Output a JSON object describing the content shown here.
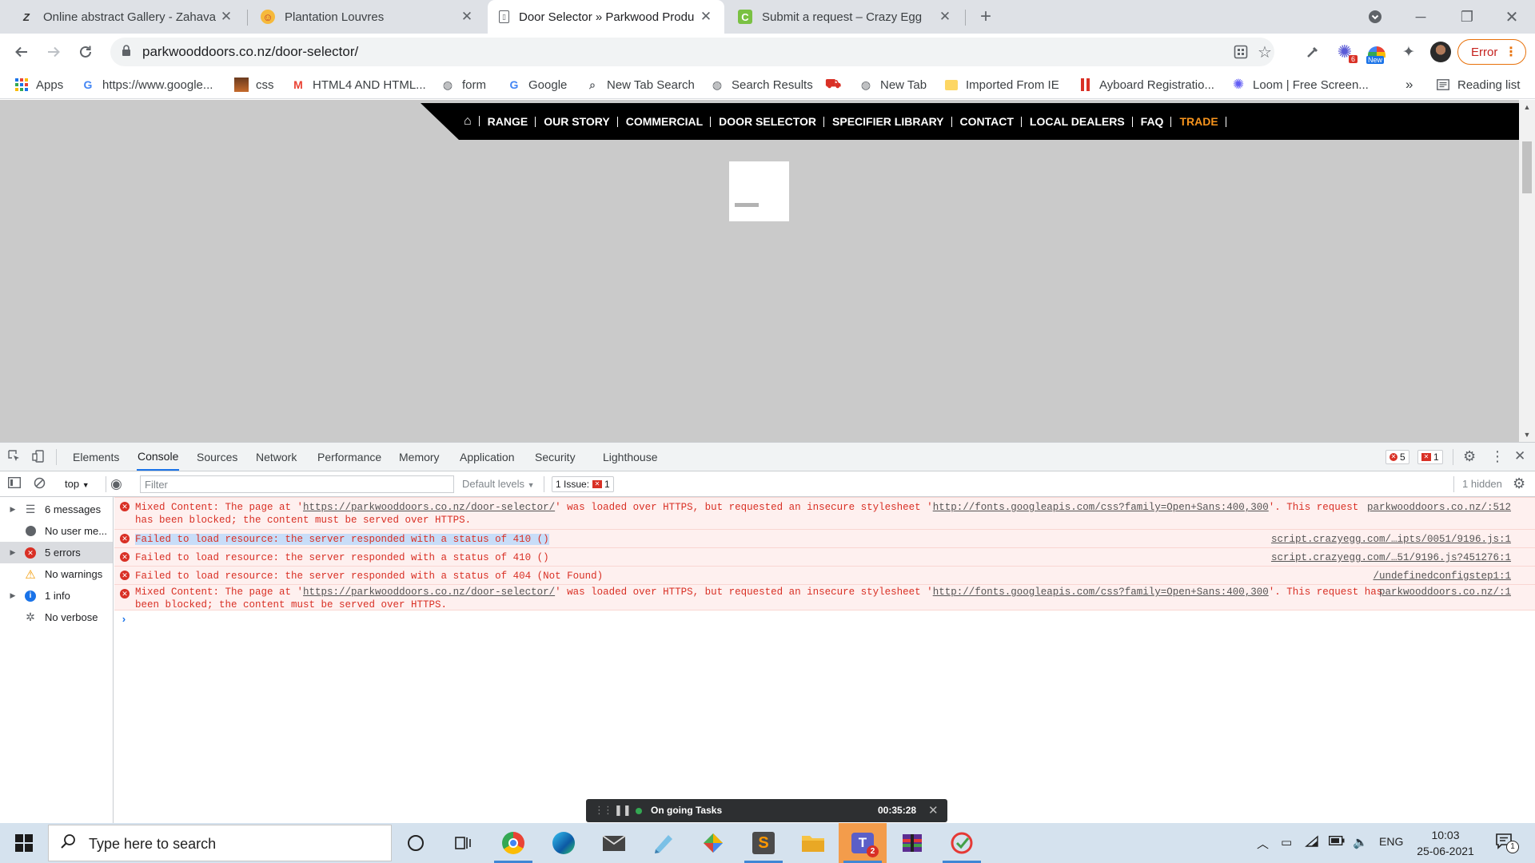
{
  "browser": {
    "tabs": [
      {
        "title": "Online abstract Gallery - Zahava",
        "favicon": "zahava-icon",
        "active": false
      },
      {
        "title": "Plantation Louvres",
        "favicon": "louvres-icon",
        "active": false
      },
      {
        "title": "Door Selector » Parkwood Produ",
        "favicon": "page-icon",
        "active": true
      },
      {
        "title": "Submit a request – Crazy Egg",
        "favicon": "crazyegg-icon",
        "active": false
      }
    ],
    "url": "parkwooddoors.co.nz/door-selector/",
    "error_button_label": "Error",
    "extension_badge": "6",
    "new_badge": "New",
    "bookmarks": [
      {
        "label": "Apps",
        "icon": "apps-grid-icon"
      },
      {
        "label": "https://www.google...",
        "icon": "google-icon"
      },
      {
        "label": "css",
        "icon": "image-icon"
      },
      {
        "label": "HTML4 AND HTML...",
        "icon": "gmail-icon"
      },
      {
        "label": "form",
        "icon": "globe-icon"
      },
      {
        "label": "Google",
        "icon": "google-icon"
      },
      {
        "label": "New Tab Search",
        "icon": "search-icon"
      },
      {
        "label": "Search Results",
        "icon": "globe-icon"
      },
      {
        "label": "",
        "icon": "cart-icon"
      },
      {
        "label": "New Tab",
        "icon": "globe-icon"
      },
      {
        "label": "Imported From IE",
        "icon": "folder-icon"
      },
      {
        "label": "Ayboard Registratio...",
        "icon": "ayboard-icon"
      },
      {
        "label": "Loom | Free Screen...",
        "icon": "loom-icon"
      }
    ],
    "bookmarks_overflow": "»",
    "reading_list_label": "Reading list"
  },
  "site": {
    "nav": [
      "RANGE",
      "OUR STORY",
      "COMMERCIAL",
      "DOOR SELECTOR",
      "SPECIFIER LIBRARY",
      "CONTACT",
      "LOCAL DEALERS",
      "FAQ",
      "TRADE"
    ],
    "accent_color": "#f7941d"
  },
  "devtools": {
    "tabs": [
      "Elements",
      "Console",
      "Sources",
      "Network",
      "Performance",
      "Memory",
      "Application",
      "Security",
      "Lighthouse"
    ],
    "active_tab": "Console",
    "error_count": "5",
    "issue_count": "1",
    "context": "top",
    "filter_placeholder": "Filter",
    "levels_label": "Default levels",
    "issues_label": "1 Issue:",
    "issues_badge": "1",
    "hidden_label": "1 hidden",
    "sidebar": [
      {
        "label": "6 messages",
        "icon": "list-icon",
        "expandable": true
      },
      {
        "label": "No user me...",
        "icon": "user-icon",
        "expandable": false
      },
      {
        "label": "5 errors",
        "icon": "error-icon",
        "expandable": true,
        "selected": true
      },
      {
        "label": "No warnings",
        "icon": "warning-icon",
        "expandable": false
      },
      {
        "label": "1 info",
        "icon": "info-icon",
        "expandable": true
      },
      {
        "label": "No verbose",
        "icon": "bug-icon",
        "expandable": false
      }
    ],
    "messages": [
      {
        "pre": "Mixed Content: The page at '",
        "link1": "https://parkwooddoors.co.nz/door-selector/",
        "mid": "' was loaded over HTTPS, but requested an insecure stylesheet '",
        "link2": "http://fonts.googleapis.com/css?family=Open+Sans:400,300",
        "post": "'. This request",
        "line2": "has been blocked; the content must be served over HTTPS.",
        "source": "parkwooddoors.co.nz/:512"
      },
      {
        "text": "Failed to load resource: the server responded with a status of 410 ()",
        "source": "script.crazyegg.com/…ipts/0051/9196.js:1",
        "highlighted": true
      },
      {
        "text": "Failed to load resource: the server responded with a status of 410 ()",
        "source": "script.crazyegg.com/…51/9196.js?451276:1"
      },
      {
        "text": "Failed to load resource: the server responded with a status of 404 (Not Found)",
        "source": "/undefinedconfigstep1:1"
      },
      {
        "pre": "Mixed Content: The page at '",
        "link1": "https://parkwooddoors.co.nz/door-selector/",
        "mid": "' was loaded over HTTPS, but requested an insecure stylesheet '",
        "link2": "http://fonts.googleapis.com/css?family=Open+Sans:400,300",
        "post": "'. This request has",
        "line2": "been blocked; the content must be served over HTTPS.",
        "source": "parkwooddoors.co.nz/:1"
      }
    ],
    "prompt": "›"
  },
  "task_overlay": {
    "label": "On going Tasks",
    "timer": "00:35:28"
  },
  "taskbar": {
    "search_placeholder": "Type here to search",
    "language": "ENG",
    "time": "10:03",
    "date": "25-06-2021",
    "teams_badge": "2",
    "notification_badge": "1"
  }
}
